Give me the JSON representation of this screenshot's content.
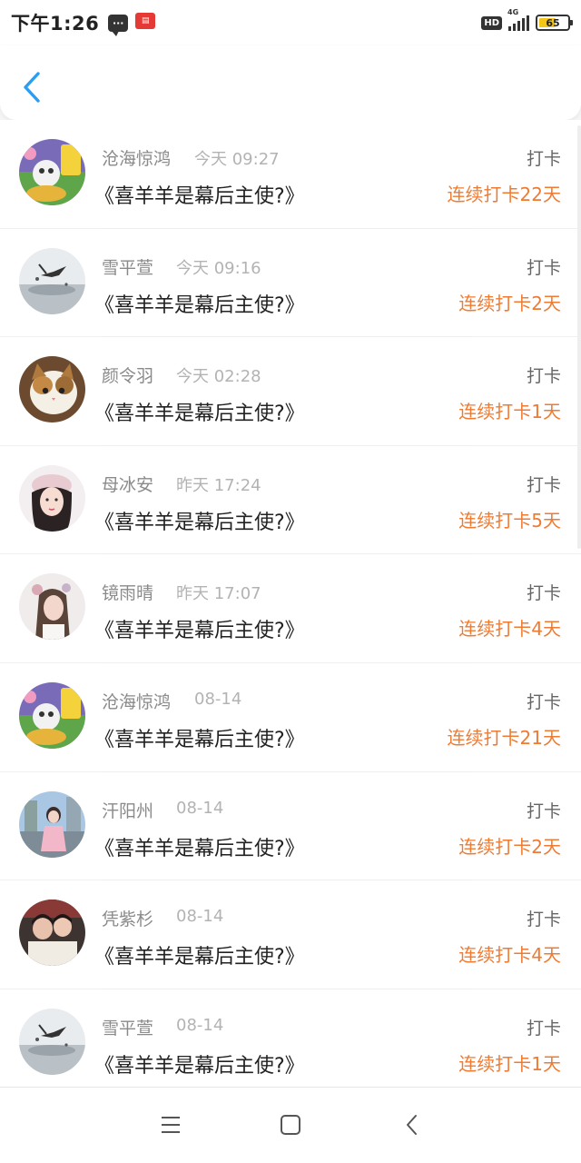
{
  "status_bar": {
    "time": "下午1:26",
    "hd_label": "HD",
    "network_label": "4G",
    "battery_level": "65",
    "battery_percent": 65,
    "notification_icons": [
      "message-icon",
      "news-app-icon"
    ]
  },
  "header": {
    "back_icon": "chevron-left-icon",
    "accent_color": "#2a9df4"
  },
  "colors": {
    "streak": "#ef7b32",
    "username": "#8a8a8a",
    "timestamp": "#b3b3b3",
    "title": "#222222"
  },
  "checkins": [
    {
      "user": "沧海惊鸿",
      "time": "今天 09:27",
      "book": "《喜羊羊是幕后主使?》",
      "action": "打卡",
      "streak": "连续打卡22天",
      "avatar": "cartoon-avatar"
    },
    {
      "user": "雪平萱",
      "time": "今天 09:16",
      "book": "《喜羊羊是幕后主使?》",
      "action": "打卡",
      "streak": "连续打卡2天",
      "avatar": "bird-avatar"
    },
    {
      "user": "颜令羽",
      "time": "今天 02:28",
      "book": "《喜羊羊是幕后主使?》",
      "action": "打卡",
      "streak": "连续打卡1天",
      "avatar": "cat-avatar"
    },
    {
      "user": "母冰安",
      "time": "昨天 17:24",
      "book": "《喜羊羊是幕后主使?》",
      "action": "打卡",
      "streak": "连续打卡5天",
      "avatar": "girl-avatar"
    },
    {
      "user": "镜雨晴",
      "time": "昨天 17:07",
      "book": "《喜羊羊是幕后主使?》",
      "action": "打卡",
      "streak": "连续打卡4天",
      "avatar": "girl-avatar-2"
    },
    {
      "user": "沧海惊鸿",
      "time": "08-14",
      "book": "《喜羊羊是幕后主使?》",
      "action": "打卡",
      "streak": "连续打卡21天",
      "avatar": "cartoon-avatar"
    },
    {
      "user": "汗阳州",
      "time": "08-14",
      "book": "《喜羊羊是幕后主使?》",
      "action": "打卡",
      "streak": "连续打卡2天",
      "avatar": "street-girl-avatar"
    },
    {
      "user": "凭紫杉",
      "time": "08-14",
      "book": "《喜羊羊是幕后主使?》",
      "action": "打卡",
      "streak": "连续打卡4天",
      "avatar": "couple-avatar"
    },
    {
      "user": "雪平萱",
      "time": "08-14",
      "book": "《喜羊羊是幕后主使?》",
      "action": "打卡",
      "streak": "连续打卡1天",
      "avatar": "bird-avatar"
    }
  ],
  "system_nav": {
    "menu_icon": "menu-icon",
    "home_icon": "home-square-icon",
    "back_icon": "system-back-icon"
  }
}
